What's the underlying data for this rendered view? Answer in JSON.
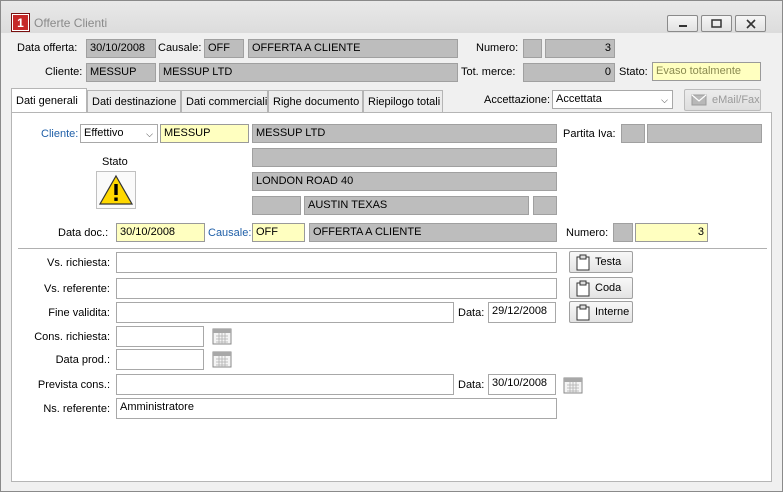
{
  "window": {
    "title": "Offerte Clienti",
    "icon_text": "1"
  },
  "header": {
    "data_offerta_label": "Data offerta:",
    "data_offerta": "30/10/2008",
    "causale_label": "Causale:",
    "causale_code": "OFF",
    "causale_desc": "OFFERTA A CLIENTE",
    "numero_label": "Numero:",
    "numero_prefix": "",
    "numero": "3",
    "cliente_label": "Cliente:",
    "cliente_code": "MESSUP",
    "cliente_name": "MESSUP LTD",
    "tot_merce_label": "Tot. merce:",
    "tot_merce": "0",
    "stato_label": "Stato:",
    "stato": "Evaso totalmente"
  },
  "tabs": [
    {
      "label": "Dati generali",
      "active": true
    },
    {
      "label": "Dati destinazione"
    },
    {
      "label": "Dati commerciali"
    },
    {
      "label": "Righe documento"
    },
    {
      "label": "Riepilogo totali"
    }
  ],
  "accettazione": {
    "label": "Accettazione:",
    "value": "Accettata"
  },
  "email_button": "eMail/Fax",
  "panel": {
    "cliente_label": "Cliente:",
    "cliente_type": "Effettivo",
    "cliente_code": "MESSUP",
    "cliente_name": "MESSUP LTD",
    "address_line2": "",
    "address": "LONDON ROAD 40",
    "cap": "",
    "city": "AUSTIN TEXAS",
    "prov": "",
    "partita_iva_label": "Partita Iva:",
    "stato_label": "Stato",
    "data_doc_label": "Data doc.:",
    "data_doc": "30/10/2008",
    "causale_label": "Causale:",
    "causale_code": "OFF",
    "causale_desc": "OFFERTA A CLIENTE",
    "numero_label": "Numero:",
    "numero": "3",
    "vs_richiesta_label": "Vs. richiesta:",
    "vs_referente_label": "Vs. referente:",
    "fine_validita_label": "Fine validita:",
    "data_label": "Data:",
    "fine_validita_data": "29/12/2008",
    "cons_richiesta_label": "Cons. richiesta:",
    "data_prod_label": "Data prod.:",
    "prevista_cons_label": "Prevista cons.:",
    "prevista_cons_data": "30/10/2008",
    "ns_referente_label": "Ns. referente:",
    "ns_referente": "Amministratore",
    "btn_testa": "Testa",
    "btn_coda": "Coda",
    "btn_interne": "Interne"
  }
}
